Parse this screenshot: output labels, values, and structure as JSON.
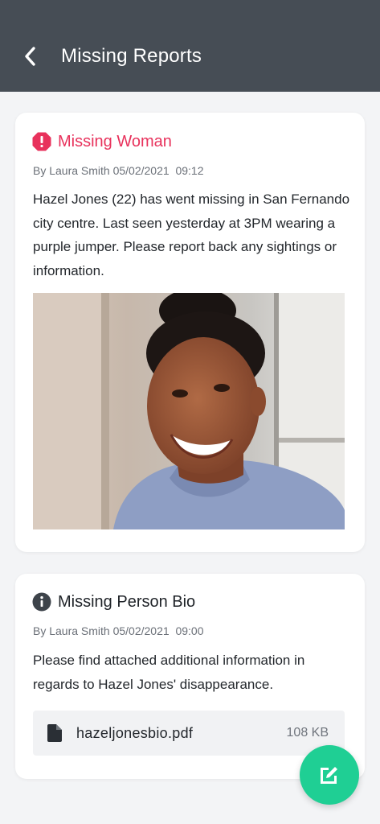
{
  "header": {
    "title": "Missing Reports",
    "back_icon": "chevron-left-icon"
  },
  "colors": {
    "header_bg": "#464d55",
    "alert": "#e8325c",
    "fab": "#1fcf94",
    "background": "#f3f4f6"
  },
  "reports": [
    {
      "icon": "alert-octagon-icon",
      "title": "Missing Woman",
      "meta": "By Laura Smith 05/02/2021  09:12",
      "body": "Hazel Jones (22) has went missing in San Fernando city centre. Last seen yesterday at 3PM wearing a purple jumper. Please report back any sightings or information.",
      "image": "photo of smiling young woman in blue hoodie"
    },
    {
      "icon": "info-icon",
      "title": "Missing Person Bio",
      "meta": "By Laura Smith 05/02/2021  09:00",
      "body": "Please find attached additional information in regards to Hazel Jones' disappearance.",
      "attachment": {
        "icon": "file-icon",
        "name": "hazeljonesbio.pdf",
        "size": "108 KB"
      }
    }
  ],
  "fab": {
    "icon": "edit-icon"
  }
}
